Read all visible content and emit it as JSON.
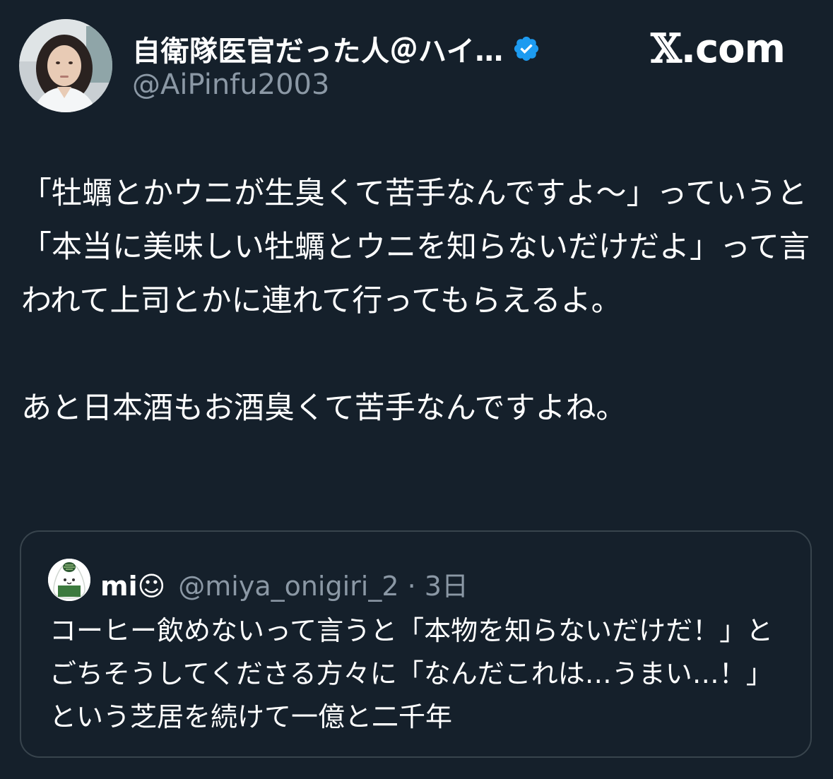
{
  "post": {
    "author": {
      "display_name": "自衛隊医官だった人＠ハイ…",
      "handle": "@AiPinfu2003",
      "verified_icon": "verified-badge-icon",
      "avatar_icon": "avatar"
    },
    "brand": {
      "x_glyph": "𝕏",
      "suffix": ".com"
    },
    "text": "「牡蠣とかウニが生臭くて苦手なんですよ〜」っていうと「本当に美味しい牡蠣とウニを知らないだけだよ」って言われて上司とかに連れて行ってもらえるよ。\n\nあと日本酒もお酒臭くて苦手なんですよね。"
  },
  "quoted": {
    "display_name": "mi☺",
    "meta": "@miya_onigiri_2 · 3日",
    "text": "コーヒー飲めないって言うと「本物を知らないだけだ！」とごちそうしてくださる方々に「なんだこれは…うまい…！」という芝居を続けて一億と二千年"
  },
  "colors": {
    "background": "#15202b",
    "text": "#ffffff",
    "secondary": "#8b98a5",
    "verified": "#1d9bf0",
    "border": "#38444d"
  }
}
